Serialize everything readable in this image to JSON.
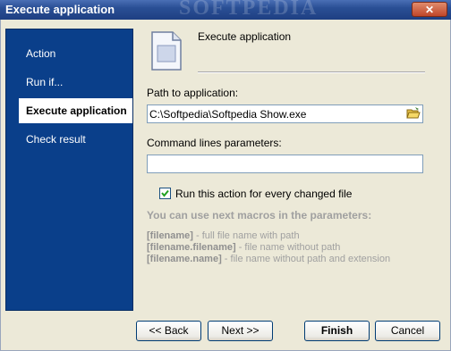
{
  "window": {
    "title": "Execute application",
    "watermark": "SOFTPEDIA",
    "close_label": "✕"
  },
  "sidebar": {
    "items": [
      {
        "label": "Action"
      },
      {
        "label": "Run if..."
      },
      {
        "label": "Execute application",
        "active": true
      },
      {
        "label": "Check result"
      }
    ]
  },
  "header": {
    "title": "Execute application",
    "icon": "document-icon"
  },
  "form": {
    "path_label": "Path to application:",
    "path_value": "C:\\Softpedia\\Softpedia Show.exe",
    "params_label": "Command lines parameters:",
    "params_value": "",
    "run_each_label": "Run this action for every changed file",
    "run_each_checked": true
  },
  "macros": {
    "title": "You can use next macros in the parameters:",
    "items": [
      {
        "name": "[filename]",
        "desc": " - full file name with path"
      },
      {
        "name": "[filename.filename]",
        "desc": " - file name without path"
      },
      {
        "name": "[filename.name]",
        "desc": " - file name without path and extension"
      }
    ]
  },
  "buttons": {
    "back": "<< Back",
    "next": "Next >>",
    "finish": "Finish",
    "cancel": "Cancel"
  },
  "colors": {
    "sidebar": "#0a3f8a",
    "titlebar": "#2a4f95"
  }
}
